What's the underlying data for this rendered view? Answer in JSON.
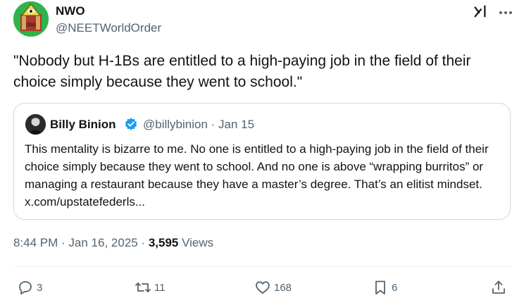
{
  "author": {
    "name": "NWO",
    "handle": "@NEETWorldOrder"
  },
  "tweet": {
    "text": "\"Nobody but H-1Bs are entitled to a high-paying job in the field of their choice simply because they went to school.\""
  },
  "quote": {
    "name": "Billy Binion",
    "handle_date": "@billybinion · Jan 15",
    "text": "This mentality is bizarre to me. No one is entitled to a high-paying job in the field of their choice simply because they went to school. And no one is above “wrapping burritos” or managing a restaurant because they have a master’s degree. That’s an elitist mindset. x.com/upstatefederls..."
  },
  "meta": {
    "time_date": "8:44 PM · Jan 16, 2025 · ",
    "views_count": "3,595",
    "views_label": " Views"
  },
  "actions": {
    "replies": "3",
    "reposts": "11",
    "likes": "168",
    "bookmarks": "6"
  },
  "icons": {
    "avatar": "green-pyramid-eye-avatar",
    "grok": "grok-icon",
    "verified": "verified-badge-icon",
    "reply": "reply-icon",
    "repost": "repost-icon",
    "like": "heart-icon",
    "bookmark": "bookmark-icon",
    "share": "share-icon"
  },
  "colors": {
    "text": "#0f1419",
    "muted": "#536471",
    "verified": "#1d9bf0",
    "border": "#cfd9de"
  }
}
